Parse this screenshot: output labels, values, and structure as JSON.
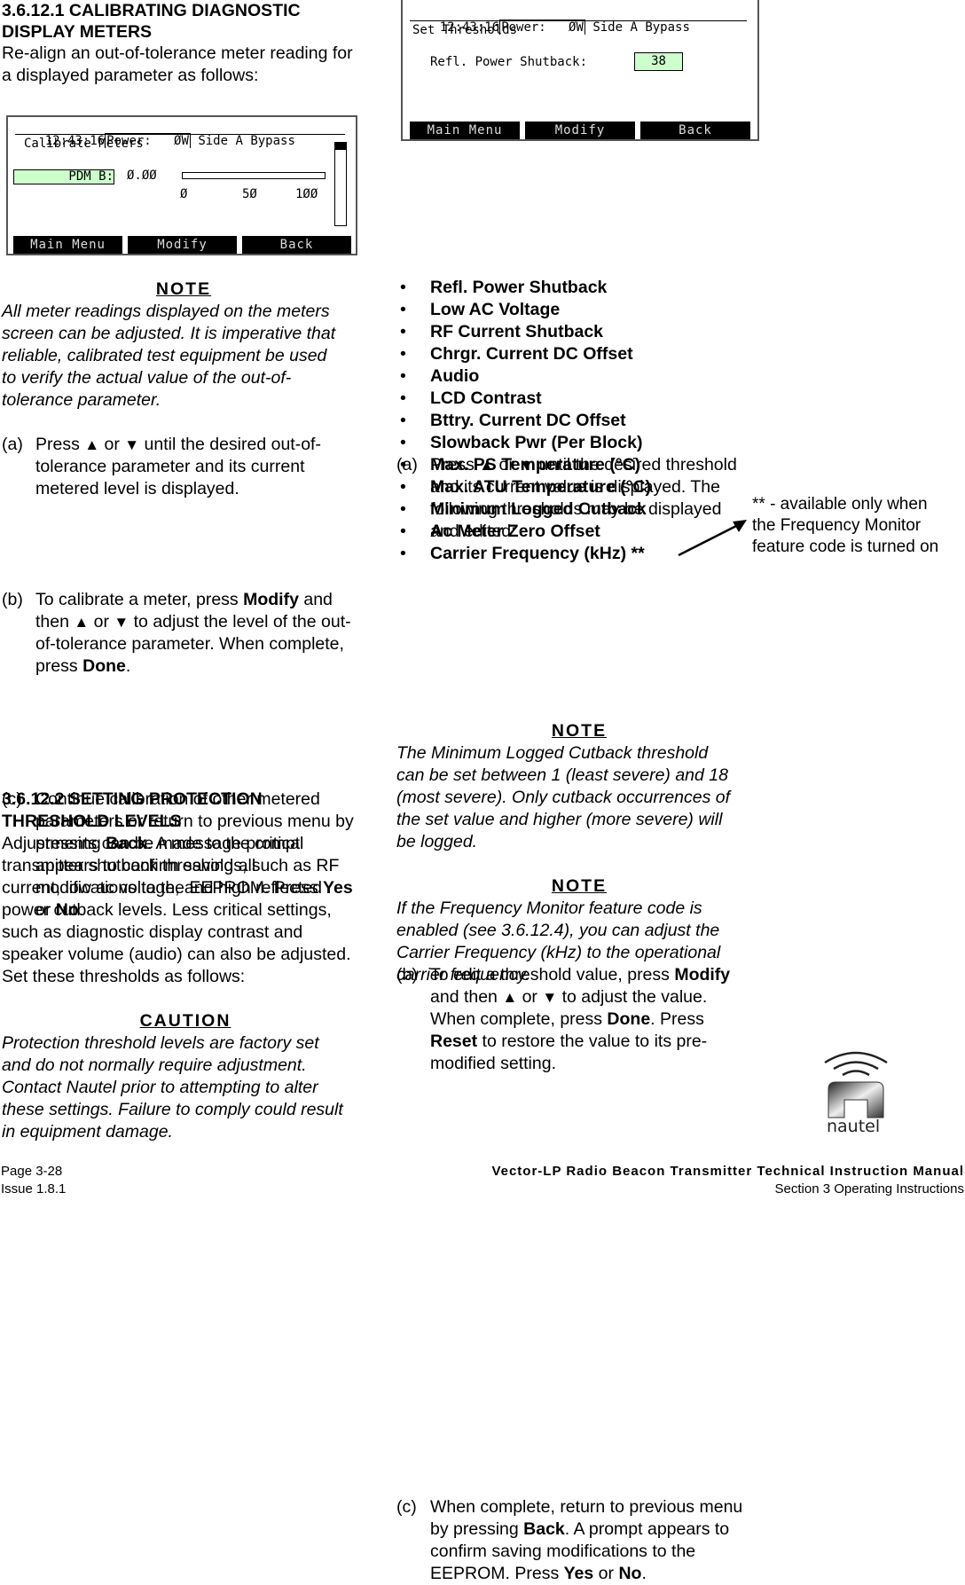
{
  "left": {
    "heading1": [
      "3.6.12.1 CALIBRATING DIAGNOSTIC",
      "DISPLAY METERS"
    ],
    "intro": [
      "Re-align an out-of-tolerance meter reading for",
      "a displayed parameter as follows:"
    ],
    "lcd_calibrate": {
      "time": "12:43:16",
      "power_label": "Power:",
      "power_value": "ØW",
      "mode": "Side A Bypass",
      "screen_title": "Calibrate Meters",
      "param_label": "PDM B:",
      "param_value": "Ø.ØØ",
      "meter_fill_percent": 0,
      "scale_ticks": [
        "Ø",
        "5Ø",
        "1ØØ"
      ],
      "scroll_position_percent": 0,
      "softkeys": [
        "Main Menu",
        "Modify",
        "Back"
      ]
    },
    "note1": {
      "title": "NOTE",
      "lines": [
        "All meter readings displayed on the meters",
        "screen can be adjusted. It is imperative that",
        "reliable, calibrated test equipment be used",
        "to verify the actual value of the out-of-",
        "tolerance parameter."
      ]
    },
    "step_a": {
      "label": "(a)",
      "line1_pre": "Press ",
      "up": "▲",
      "or": " or ",
      "down": "▼",
      "line1_post": " until the desired out-of-",
      "lines": [
        "tolerance parameter and its current",
        "metered level is displayed."
      ]
    },
    "step_b": {
      "label": "(b)",
      "l1_pre": "To calibrate a meter, press ",
      "l1_bold": "Modify",
      "l1_post": " and",
      "l2_pre": "then ",
      "up": "▲",
      "or": " or ",
      "down": "▼",
      "l2_post": " to adjust the level of the out-",
      "l3": "of-tolerance parameter. When complete,",
      "l4_pre": "press ",
      "l4_bold": "Done",
      "l4_post": "."
    },
    "step_c": {
      "label": "(c)",
      "l1": "Continue calibration of other metered",
      "l2": "parameters or return to previous menu by",
      "l3_pre": "pressing ",
      "l3_bold": "Back",
      "l3_post": ". A message prompt",
      "l4": "appears to confirm saving all",
      "l5_pre": "modifications to the EEPROM. Press ",
      "l5_bold": "Yes",
      "l6_pre": "or ",
      "l6_bold": "No",
      "l6_post": "."
    },
    "heading2": [
      "3.6.12.2 SETTING PROTECTION",
      "THRESHOLD LEVELS"
    ],
    "body2": [
      "Adjustments can be made to the critical",
      "transmitter shutback thresholds, such as RF",
      "current, low ac voltage, and high reflected",
      "power cutback levels. Less critical settings,",
      "such as diagnostic display contrast and",
      "speaker volume (audio) can also be adjusted.",
      "Set these thresholds as follows:"
    ],
    "caution": {
      "title": "CAUTION",
      "lines": [
        "Protection threshold levels are factory set",
        "and do not normally require adjustment.",
        "Contact Nautel prior to attempting to alter",
        "these settings. Failure to comply could result",
        "in equipment damage."
      ]
    }
  },
  "right": {
    "lcd_thresholds": {
      "time": "12:43:16",
      "power_label": "Power:",
      "power_value": "ØW",
      "mode": "Side A Bypass",
      "screen_title": "Set Thresholds",
      "field_label": "Refl. Power Shutback:",
      "field_value": "38",
      "softkeys": [
        "Main Menu",
        "Modify",
        "Back"
      ]
    },
    "step_a": {
      "label": "(a)",
      "l1_pre": "Press ",
      "up": "▲",
      "or": " or ",
      "down": "▼",
      "l1_post": " until the desired threshold",
      "lines": [
        "and its current value is displayed. The",
        "following thresholds may be displayed",
        "and edited:"
      ]
    },
    "bullet": "•",
    "thresholds": [
      "Refl. Power Shutback",
      "Low AC Voltage",
      "RF Current Shutback",
      "Chrgr. Current DC Offset",
      "Audio",
      "LCD Contrast",
      "Bttry. Current DC Offset",
      "Slowback Pwr (Per Block)",
      "Max. PS Temperature (°C)",
      "Max. ATU Temperature (°C)",
      "Minimum Logged Cutback",
      "Ac Meter Zero Offset",
      "Carrier Frequency (kHz) **"
    ],
    "annotation": [
      "** - available only when",
      "the Frequency Monitor",
      "feature code is turned on"
    ],
    "step_b": {
      "label": "(b)",
      "l1_pre": "To edit a threshold value, press ",
      "l1_bold": "Modify",
      "l2_pre": "and then ",
      "up": "▲",
      "or": " or ",
      "down": "▼",
      "l2_post": " to adjust the value.",
      "l3_pre": "When complete, press ",
      "l3_bold": "Done",
      "l3_post": ". Press",
      "l4_bold": "Reset",
      "l4_post": " to restore the value to its pre-",
      "l5": "modified setting."
    },
    "note2": {
      "title": "NOTE",
      "lines": [
        "The Minimum Logged Cutback threshold",
        "can be set between 1 (least severe) and 18",
        "(most severe). Only cutback occurrences of",
        "the set value and higher (more severe) will",
        "be logged."
      ]
    },
    "note3": {
      "title": "NOTE",
      "lines": [
        "If the Frequency Monitor feature code is",
        "enabled (see 3.6.12.4), you can adjust the",
        "Carrier Frequency (kHz) to the operational",
        "carrier frequency."
      ]
    },
    "step_c": {
      "label": "(c)",
      "l1": "When complete, return to previous menu",
      "l2_pre": "by pressing ",
      "l2_bold": "Back",
      "l2_post": ". A prompt appears to",
      "l3": "confirm saving modifications to the",
      "l4_pre": "EEPROM. Press ",
      "l4_bold": "Yes",
      "l4_mid": " or ",
      "l4_bold2": "No",
      "l4_post": "."
    },
    "logo_text": "nautel"
  },
  "footer": {
    "page": "Page 3-28",
    "issue": "Issue 1.8.1",
    "manual_title": "Vector-LP Radio Beacon Transmitter Technical Instruction Manual",
    "section": "Section 3  Operating Instructions"
  }
}
